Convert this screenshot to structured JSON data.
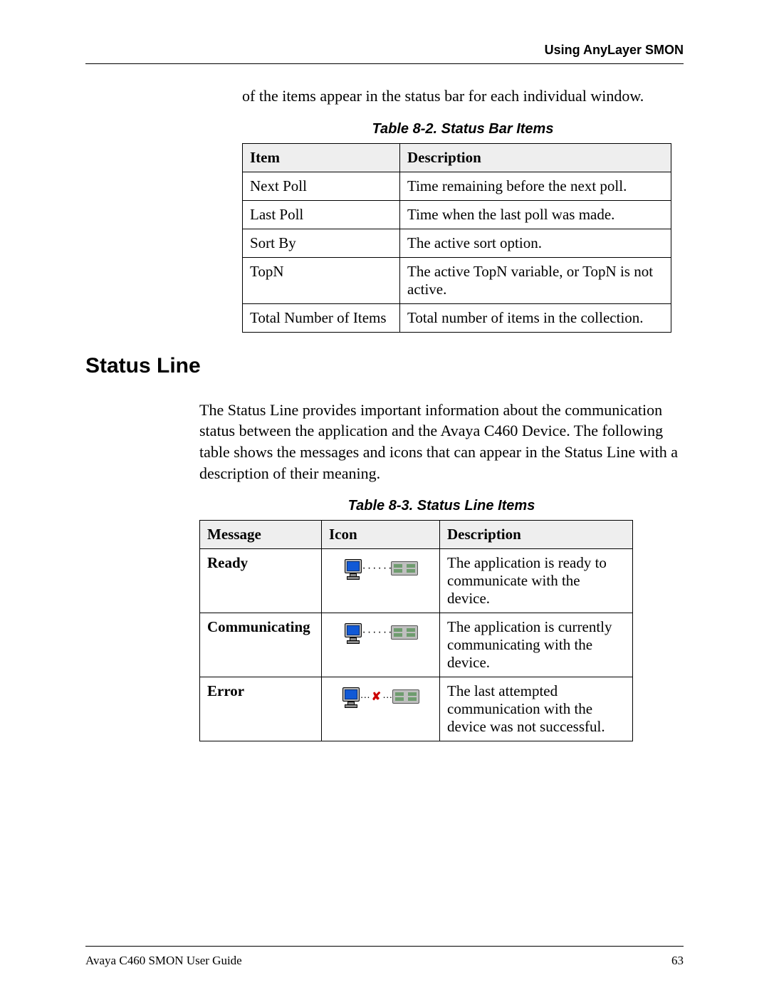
{
  "header": {
    "running_head": "Using AnyLayer SMON"
  },
  "intro_continued": "of the items appear in the status bar for each individual window.",
  "table82": {
    "caption": "Table 8-2.  Status Bar Items",
    "headers": {
      "c1": "Item",
      "c2": "Description"
    },
    "rows": [
      {
        "c1": "Next Poll",
        "c2": "Time remaining before the next poll."
      },
      {
        "c1": "Last Poll",
        "c2": "Time when the last poll was made."
      },
      {
        "c1": "Sort By",
        "c2": "The active sort option."
      },
      {
        "c1": "TopN",
        "c2": "The active TopN variable, or TopN is not active."
      },
      {
        "c1": "Total Number of Items",
        "c2": "Total number of items in the collection."
      }
    ]
  },
  "section_heading": "Status Line",
  "status_line_intro": "The Status Line provides important information about the communication status between the application and the Avaya C460 Device. The following table shows the messages and icons that can appear in the Status Line with a description of their meaning.",
  "table83": {
    "caption": "Table 8-3.  Status Line Items",
    "headers": {
      "c1": "Message",
      "c2": "Icon",
      "c3": "Description"
    },
    "rows": [
      {
        "message": "Ready",
        "icon": "ok",
        "desc": "The application is ready to communicate with the device."
      },
      {
        "message": "Communicating",
        "icon": "ok",
        "desc": "The application is currently communicating with the device."
      },
      {
        "message": "Error",
        "icon": "error",
        "desc": "The last attempted communication with the device was not successful."
      }
    ]
  },
  "footer": {
    "doc_title": "Avaya C460 SMON User Guide",
    "page_number": "63"
  },
  "icons": {
    "computer": "computer-icon",
    "switch": "switch-icon",
    "dots_ok": "········",
    "dots_err_left": "···",
    "dots_err_right": "···"
  }
}
